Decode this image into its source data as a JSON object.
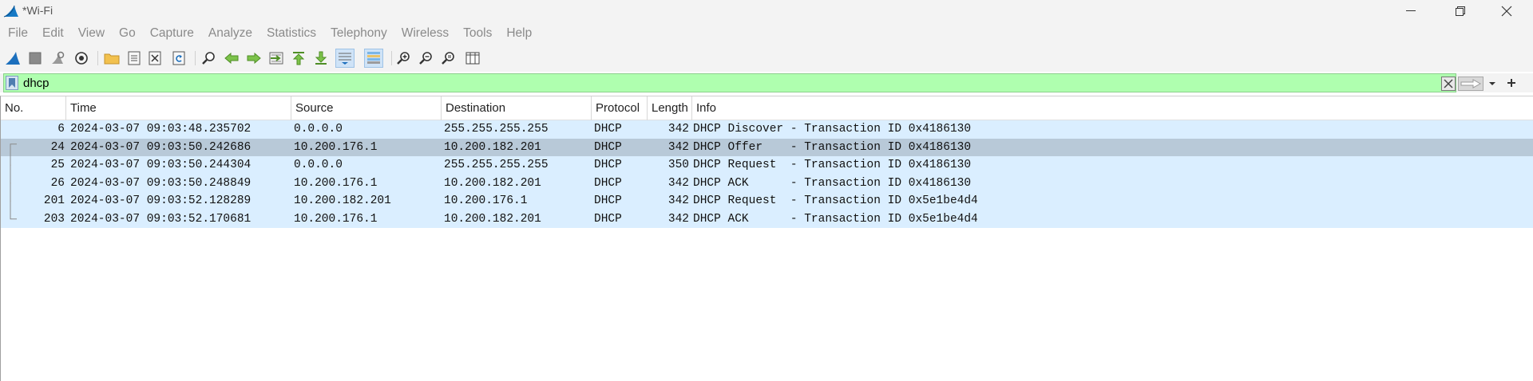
{
  "window": {
    "title": "*Wi-Fi",
    "icon": "wireshark-fin-icon"
  },
  "menu": [
    "File",
    "Edit",
    "View",
    "Go",
    "Capture",
    "Analyze",
    "Statistics",
    "Telephony",
    "Wireless",
    "Tools",
    "Help"
  ],
  "toolbar": {
    "buttons": [
      "start-capture-icon",
      "stop-capture-icon",
      "restart-capture-icon",
      "capture-options-icon",
      "open-file-icon",
      "save-file-icon",
      "close-file-icon",
      "reload-file-icon",
      "find-packet-icon",
      "go-back-icon",
      "go-forward-icon",
      "go-to-packet-icon",
      "first-packet-icon",
      "last-packet-icon",
      "auto-scroll-icon",
      "colorize-icon",
      "zoom-in-icon",
      "zoom-out-icon",
      "normal-size-icon",
      "resize-columns-icon"
    ]
  },
  "filter": {
    "value": "dhcp",
    "background": "#afffaf"
  },
  "columns": [
    "No.",
    "Time",
    "Source",
    "Destination",
    "Protocol",
    "Length",
    "Info"
  ],
  "packets": [
    {
      "no": "6",
      "time": "2024-03-07 09:03:48.235702",
      "source": "0.0.0.0",
      "destination": "255.255.255.255",
      "protocol": "DHCP",
      "length": "342",
      "info": "DHCP Discover - Transaction ID 0x4186130",
      "selected": false
    },
    {
      "no": "24",
      "time": "2024-03-07 09:03:50.242686",
      "source": "10.200.176.1",
      "destination": "10.200.182.201",
      "protocol": "DHCP",
      "length": "342",
      "info": "DHCP Offer    - Transaction ID 0x4186130",
      "selected": true
    },
    {
      "no": "25",
      "time": "2024-03-07 09:03:50.244304",
      "source": "0.0.0.0",
      "destination": "255.255.255.255",
      "protocol": "DHCP",
      "length": "350",
      "info": "DHCP Request  - Transaction ID 0x4186130",
      "selected": false
    },
    {
      "no": "26",
      "time": "2024-03-07 09:03:50.248849",
      "source": "10.200.176.1",
      "destination": "10.200.182.201",
      "protocol": "DHCP",
      "length": "342",
      "info": "DHCP ACK      - Transaction ID 0x4186130",
      "selected": false
    },
    {
      "no": "201",
      "time": "2024-03-07 09:03:52.128289",
      "source": "10.200.182.201",
      "destination": "10.200.176.1",
      "protocol": "DHCP",
      "length": "342",
      "info": "DHCP Request  - Transaction ID 0x5e1be4d4",
      "selected": false
    },
    {
      "no": "203",
      "time": "2024-03-07 09:03:52.170681",
      "source": "10.200.176.1",
      "destination": "10.200.182.201",
      "protocol": "DHCP",
      "length": "342",
      "info": "DHCP ACK      - Transaction ID 0x5e1be4d4",
      "selected": false
    }
  ],
  "colors": {
    "row": "#daeeff",
    "selected_row": "#b8c9d8",
    "filter_ok": "#afffaf"
  }
}
